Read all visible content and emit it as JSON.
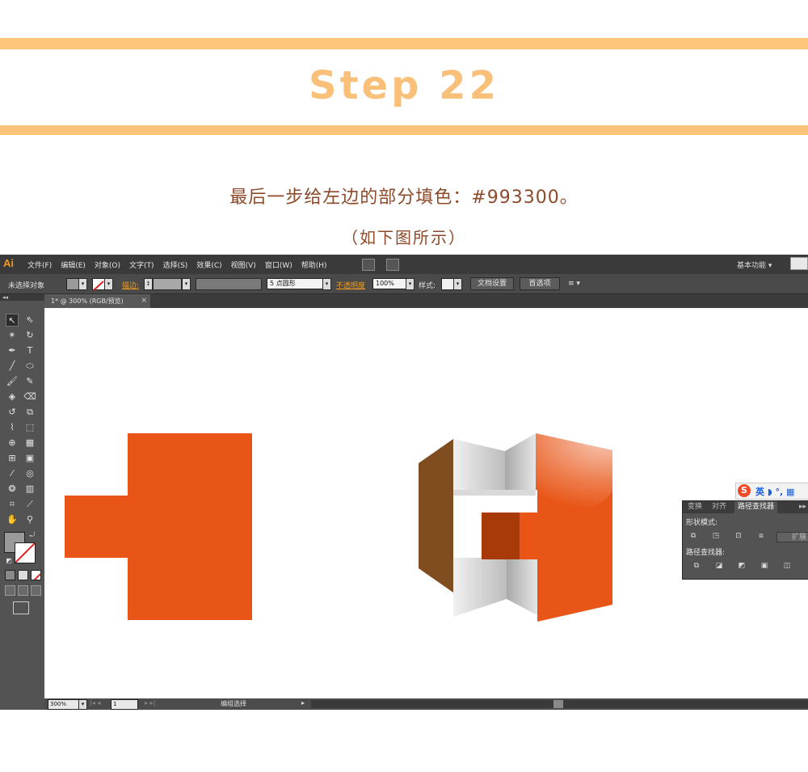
{
  "header": {
    "step_title": "Step 22",
    "instruction": "最后一步给左边的部分填色：#993300。",
    "subnote": "（如下图所示）",
    "band_color": "#fdc47a"
  },
  "app": {
    "logo": "Ai",
    "menu": [
      "文件(F)",
      "编辑(E)",
      "对象(O)",
      "文字(T)",
      "选择(S)",
      "效果(C)",
      "视图(V)",
      "窗口(W)",
      "帮助(H)"
    ],
    "workspace": "基本功能",
    "workspace_arrow": "▾"
  },
  "control_bar": {
    "selection_status": "未选择对象",
    "stroke_label": "描边:",
    "brush_size": "5 点圆形",
    "opacity_label": "不透明度",
    "opacity_value": "100%",
    "style_label": "样式:",
    "doc_setup_button": "文档设置",
    "preferences_button": "首选项"
  },
  "document_tab": {
    "title": "1* @ 300% (RGB/预览)",
    "close": "×"
  },
  "toolbox": {
    "grip": "◂◂",
    "icons": [
      "selection-icon",
      "direct-selection-icon",
      "magic-wand-icon",
      "lasso-icon",
      "pen-icon",
      "type-icon",
      "line-icon",
      "ellipse-icon",
      "brush-icon",
      "pencil-icon",
      "blob-brush-icon",
      "eraser-icon",
      "rotate-icon",
      "scale-icon",
      "warp-icon",
      "free-transform-icon",
      "shape-builder-icon",
      "perspective-icon",
      "mesh-icon",
      "gradient-icon",
      "eyedropper-icon",
      "blend-icon",
      "symbol-sprayer-icon",
      "graph-icon",
      "artboard-icon",
      "slice-icon",
      "hand-icon",
      "zoom-icon"
    ]
  },
  "status_bar": {
    "zoom": "300%",
    "artboard": "1",
    "status_text": "编组选择"
  },
  "ime": {
    "text": "英 ◗ °, ▦"
  },
  "pathfinder_panel": {
    "tabs": [
      "变换",
      "对齐",
      "路径查找器"
    ],
    "menu_icon": "▸▸",
    "shape_modes_label": "形状模式:",
    "pathfinders_label": "路径查找器:",
    "expand_button": "扩展"
  },
  "artwork": {
    "left_shape_color": "#e85516",
    "left_face_color": "#7f4d1f",
    "front_face_color": "#e85516",
    "inner_shadow_color": "#a83a0a"
  }
}
